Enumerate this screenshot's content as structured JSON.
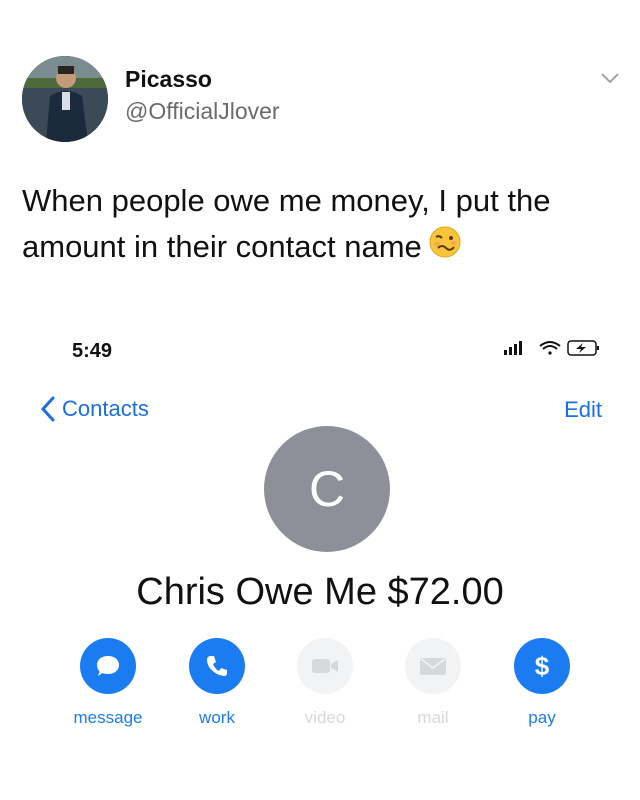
{
  "tweet": {
    "display_name": "Picasso",
    "handle": "@OfficialJlover",
    "text": "When people owe me money, I put the\namount in their contact name",
    "emoji": "woozy-face-emoji",
    "menu_icon": "chevron-down-icon"
  },
  "phone": {
    "status_time": "5:49",
    "status_icons": [
      "signal-bars-icon",
      "wifi-icon",
      "battery-charging-icon"
    ],
    "back_label": "Contacts",
    "edit_label": "Edit",
    "contact_initial": "C",
    "contact_name": "Chris Owe Me $72.00",
    "actions": [
      {
        "label": "message",
        "icon": "message-bubble-icon",
        "enabled": true
      },
      {
        "label": "work",
        "icon": "phone-icon",
        "enabled": true
      },
      {
        "label": "video",
        "icon": "video-camera-icon",
        "enabled": false
      },
      {
        "label": "mail",
        "icon": "mail-envelope-icon",
        "enabled": false
      },
      {
        "label": "pay",
        "icon": "dollar-icon",
        "enabled": true
      }
    ]
  },
  "colors": {
    "ios_blue": "#1b7cf2",
    "avatar_gray": "#8e9099",
    "disabled_gray": "#d6d8dc"
  }
}
